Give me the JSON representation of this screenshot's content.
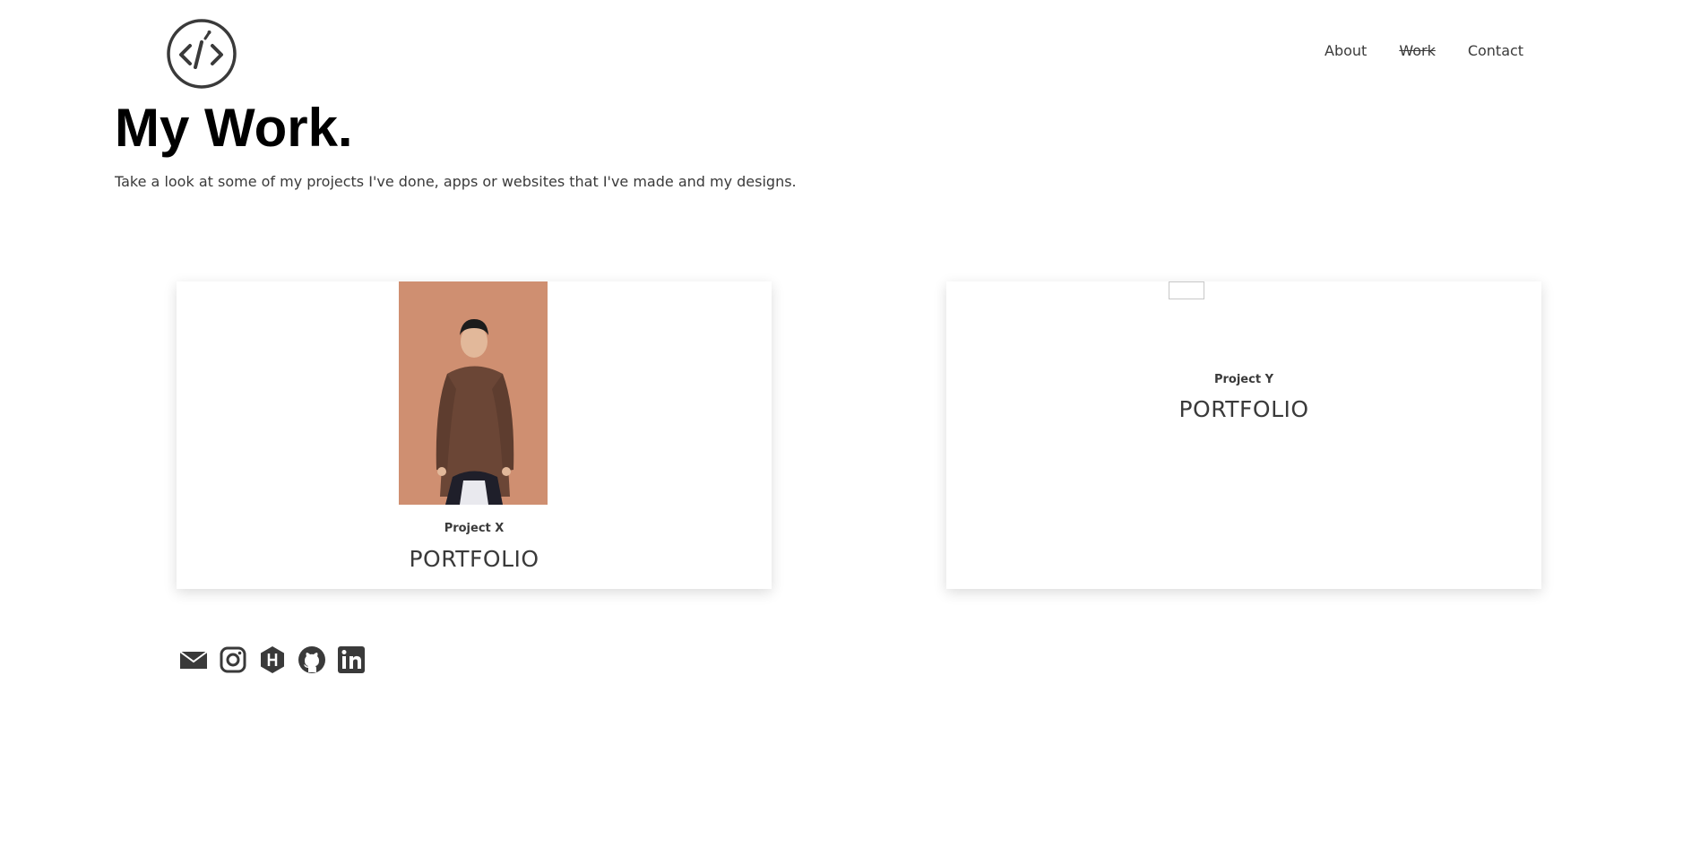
{
  "nav": {
    "about": "About",
    "work": "Work",
    "contact": "Contact"
  },
  "header": {
    "title": "My Work.",
    "subtitle": "Take a look at some of my projects I've done, apps or websites that I've made and my designs."
  },
  "projects": [
    {
      "label": "Project X",
      "title": "PORTFOLIO"
    },
    {
      "label": "Project Y",
      "title": "PORTFOLIO"
    }
  ],
  "socials": [
    "envelope-icon",
    "instagram-icon",
    "hashnode-icon",
    "github-icon",
    "linkedin-icon"
  ],
  "colors": {
    "text": "#3a3a3a",
    "heading": "#000000",
    "photo_background": "#d29274",
    "shirt": "#6b4636"
  }
}
